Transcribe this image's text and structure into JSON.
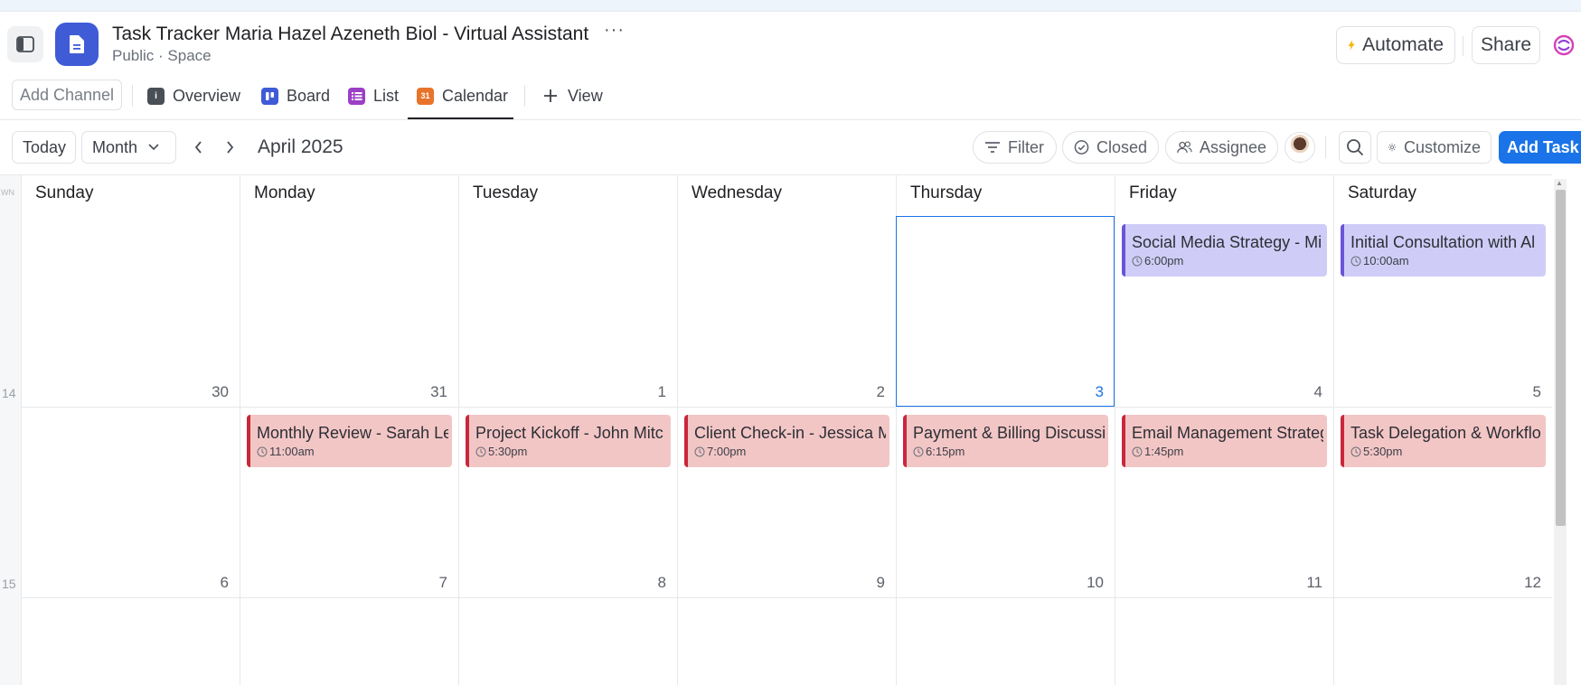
{
  "header": {
    "title": "Task Tracker Maria Hazel Azeneth Biol - Virtual Assistant",
    "more": "···",
    "subtitle": "Public · Space",
    "automate_label": "Automate",
    "share_label": "Share"
  },
  "views": {
    "add_channel": "Add Channel",
    "tabs": [
      {
        "label": "Overview",
        "icon": "info-icon",
        "color": "#4a4f57"
      },
      {
        "label": "Board",
        "icon": "board-icon",
        "color": "#3f5bd6"
      },
      {
        "label": "List",
        "icon": "list-icon",
        "color": "#9c3fc7"
      },
      {
        "label": "Calendar",
        "icon": "calendar-icon",
        "color": "#e8742b",
        "active": true,
        "icon_text": "31"
      }
    ],
    "add_view": "View"
  },
  "toolbar": {
    "today": "Today",
    "range": "Month",
    "period": "April 2025",
    "filter": "Filter",
    "closed": "Closed",
    "assignee": "Assignee",
    "customize": "Customize",
    "add_task": "Add Task"
  },
  "calendar": {
    "week_label": "WN",
    "days": [
      "Sunday",
      "Monday",
      "Tuesday",
      "Wednesday",
      "Thursday",
      "Friday",
      "Saturday"
    ],
    "weeks": [
      {
        "number": "14",
        "dates": [
          "30",
          "31",
          "1",
          "2",
          "3",
          "4",
          "5"
        ]
      },
      {
        "number": "15",
        "dates": [
          "6",
          "7",
          "8",
          "9",
          "10",
          "11",
          "12"
        ]
      }
    ],
    "today_date": "3",
    "events": [
      {
        "title": "Social Media Strategy - Mi",
        "time": "6:00pm",
        "color": "#cfcdf7"
      },
      {
        "title": "Initial Consultation with Al",
        "time": "10:00am",
        "color": "#cfcdf7"
      },
      {
        "title": "Monthly Review - Sarah Le",
        "time": "11:00am",
        "color": "#f3c6c6"
      },
      {
        "title": "Project Kickoff - John Mitc",
        "time": "5:30pm",
        "color": "#f3c6c6"
      },
      {
        "title": "Client Check-in - Jessica M",
        "time": "7:00pm",
        "color": "#f3c6c6"
      },
      {
        "title": "Payment & Billing Discussi",
        "time": "6:15pm",
        "color": "#f3c6c6"
      },
      {
        "title": "Email Management Strateg",
        "time": "1:45pm",
        "color": "#f3c6c6"
      },
      {
        "title": "Task Delegation & Workflo",
        "time": "5:30pm",
        "color": "#f3c6c6"
      }
    ]
  }
}
